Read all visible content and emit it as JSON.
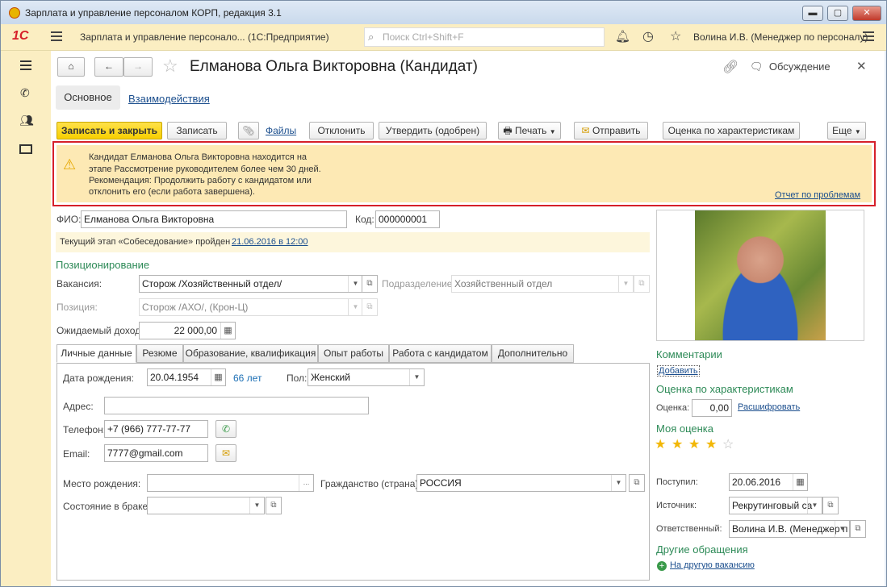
{
  "window": {
    "title": "Зарплата и управление персоналом КОРП, редакция 3.1",
    "min": "▬",
    "max": "▢",
    "close": "✕"
  },
  "appbar": {
    "logo": "1С",
    "title": "Зарплата и управление персонало... (1С:Предприятие)",
    "search_placeholder": "Поиск Ctrl+Shift+F",
    "user": "Волина И.В. (Менеджер по персоналу)"
  },
  "sidebar": {
    "items": [
      "menu-icon",
      "phone-icon",
      "people-icon",
      "card-icon"
    ]
  },
  "header": {
    "title": "Елманова Ольга Викторовна (Кандидат)",
    "discussion": "Обсуждение"
  },
  "tabs_top": {
    "main": "Основное",
    "interactions": "Взаимодействия"
  },
  "toolbar": {
    "save_close": "Записать и закрыть",
    "save": "Записать",
    "files": "Файлы",
    "reject": "Отклонить",
    "approve": "Утвердить (одобрен)",
    "print": "Печать",
    "send": "Отправить",
    "rating": "Оценка по характеристикам",
    "more": "Еще"
  },
  "warning": {
    "line1": "Кандидат Елманова Ольга Викторовна находится на",
    "line2": "этапе Рассмотрение руководителем более чем 30 дней.",
    "line3": "Рекомендация: Продолжить работу с кандидатом или",
    "line4": "отклонить его (если работа завершена).",
    "report_link": "Отчет по проблемам"
  },
  "form": {
    "fio_label": "ФИО:",
    "fio": "Елманова Ольга Викторовна",
    "code_label": "Код:",
    "code": "000000001",
    "stage_text": "Текущий этап «Собеседование» пройден",
    "stage_link": "21.06.2016 в 12:00",
    "positioning": "Позиционирование",
    "vacancy_label": "Вакансия:",
    "vacancy": "Сторож /Хозяйственный отдел/",
    "division_label": "Подразделение:",
    "division": "Хозяйственный отдел",
    "position_label": "Позиция:",
    "position": "Сторож /АХО/, (Крон-Ц)",
    "income_label": "Ожидаемый доход:",
    "income": "22 000,00"
  },
  "tabs": [
    "Личные данные",
    "Резюме",
    "Образование, квалификация",
    "Опыт работы",
    "Работа с кандидатом",
    "Дополнительно"
  ],
  "personal": {
    "birth_label": "Дата рождения:",
    "birth": "20.04.1954",
    "age": "66 лет",
    "sex_label": "Пол:",
    "sex": "Женский",
    "address_label": "Адрес:",
    "address": "",
    "phone_label": "Телефон:",
    "phone": "+7 (966) 777-77-77",
    "email_label": "Email:",
    "email": "7777@gmail.com",
    "birthplace_label": "Место рождения:",
    "birthplace": "",
    "citizenship_label": "Гражданство (страна):",
    "citizenship": "РОССИЯ",
    "marital_label": "Состояние в браке:",
    "marital": ""
  },
  "right": {
    "comments": "Комментарии",
    "add": "Добавить",
    "rating_title": "Оценка по характеристикам",
    "score_label": "Оценка:",
    "score": "0,00",
    "decode": "Расшифровать",
    "my_rating": "Моя оценка",
    "stars_filled": 4,
    "stars_total": 5,
    "arrived_label": "Поступил:",
    "arrived": "20.06.2016",
    "source_label": "Источник:",
    "source": "Рекрутинговый са",
    "responsible_label": "Ответственный:",
    "responsible": "Волина И.В. (Менеджер п",
    "other": "Другие обращения",
    "other_link": "На другую вакансию"
  },
  "colors": {
    "accent_yellow": "#ffd300",
    "warning_bg": "#fde9b4",
    "warning_border": "#d6202a",
    "green": "#2d8a57",
    "link": "#1c4f8e"
  }
}
